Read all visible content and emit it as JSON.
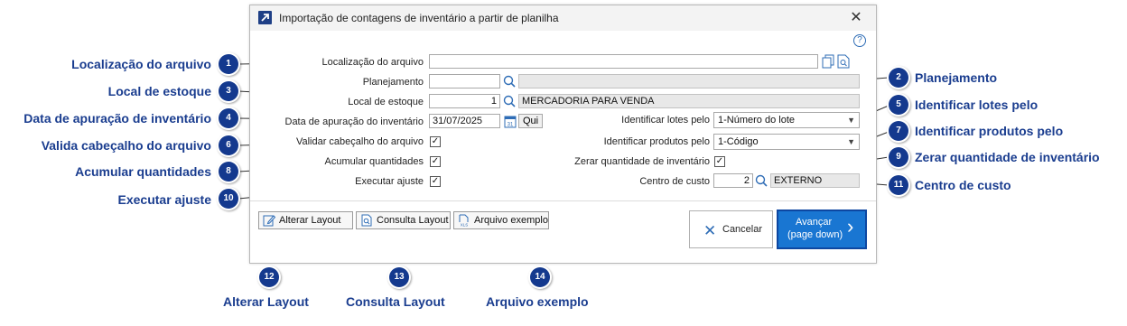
{
  "dialog": {
    "title": "Importação de contagens de inventário a partir de planilha",
    "close_glyph": "✕",
    "help_glyph": "?"
  },
  "form": {
    "file_label": "Localização do arquivo",
    "file_value": "",
    "planning_label": "Planejamento",
    "planning_value": "",
    "planning_desc": "",
    "stock_label": "Local de estoque",
    "stock_value": "1",
    "stock_desc": "MERCADORIA PARA VENDA",
    "date_label": "Data de apuração do inventário",
    "date_value": "31/07/2025",
    "weekday": "Qui",
    "validate_label": "Validar cabeçalho do arquivo",
    "validate_checked": true,
    "accumulate_label": "Acumular quantidades",
    "accumulate_checked": true,
    "adjust_label": "Executar ajuste",
    "adjust_checked": true,
    "lots_label": "Identificar lotes pelo",
    "lots_value": "1-Número do lote",
    "products_label": "Identificar produtos pelo",
    "products_value": "1-Código",
    "zero_label": "Zerar quantidade de inventário",
    "zero_checked": true,
    "cost_label": "Centro de custo",
    "cost_value": "2",
    "cost_desc": "EXTERNO",
    "check_glyph": "✓",
    "dropdown_glyph": "▼"
  },
  "buttons": {
    "alter_layout": "Alterar Layout",
    "consult_layout": "Consulta Layout",
    "example_file": "Arquivo exemplo",
    "cancel": "Cancelar",
    "next_line1": "Avançar",
    "next_line2": "(page down)",
    "next_glyph": "›",
    "cancel_glyph": "✕"
  },
  "callouts": [
    {
      "n": "1",
      "text": "Localização do arquivo"
    },
    {
      "n": "2",
      "text": "Planejamento"
    },
    {
      "n": "3",
      "text": "Local de estoque"
    },
    {
      "n": "4",
      "text": "Data de apuração de inventário"
    },
    {
      "n": "5",
      "text": "Identificar lotes pelo"
    },
    {
      "n": "6",
      "text": "Valida cabeçalho do arquivo"
    },
    {
      "n": "7",
      "text": "Identificar produtos pelo"
    },
    {
      "n": "8",
      "text": "Acumular quantidades"
    },
    {
      "n": "9",
      "text": "Zerar quantidade de inventário"
    },
    {
      "n": "10",
      "text": "Executar ajuste"
    },
    {
      "n": "11",
      "text": "Centro de custo"
    },
    {
      "n": "12",
      "text": "Alterar Layout"
    },
    {
      "n": "13",
      "text": "Consulta Layout"
    },
    {
      "n": "14",
      "text": "Arquivo exemplo"
    }
  ],
  "colors": {
    "accent": "#1976d2",
    "callout": "#1a3d8f",
    "badge": "#14398e"
  }
}
